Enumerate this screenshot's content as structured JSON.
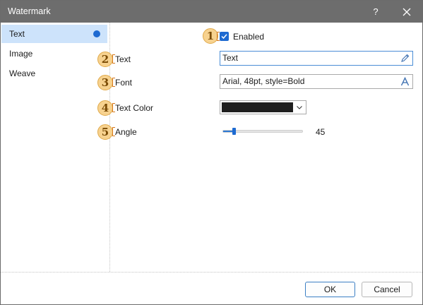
{
  "window": {
    "title": "Watermark",
    "help_label": "?",
    "close_icon": "close-icon"
  },
  "sidebar": {
    "items": [
      {
        "label": "Text",
        "selected": true
      },
      {
        "label": "Image",
        "selected": false
      },
      {
        "label": "Weave",
        "selected": false
      }
    ]
  },
  "form": {
    "enabled": {
      "label": "Enabled",
      "checked": true
    },
    "text": {
      "label": "Text",
      "value": "Text",
      "icon": "pencil-icon"
    },
    "font": {
      "label": "Font",
      "value": "Arial, 48pt, style=Bold",
      "icon": "font-a-icon"
    },
    "text_color": {
      "label": "Text Color",
      "value": "#1f1f1f"
    },
    "angle": {
      "label": "Angle",
      "value": "45",
      "slider_fraction": 0.14
    }
  },
  "callouts": [
    "1",
    "2",
    "3",
    "4",
    "5"
  ],
  "buttons": {
    "ok": "OK",
    "cancel": "Cancel"
  },
  "colors": {
    "titlebar": "#6d6d6d",
    "accent": "#1e6ad1",
    "selection": "#cde3fb",
    "callout_fill": "#f7d28f",
    "callout_border": "#e0a949"
  }
}
